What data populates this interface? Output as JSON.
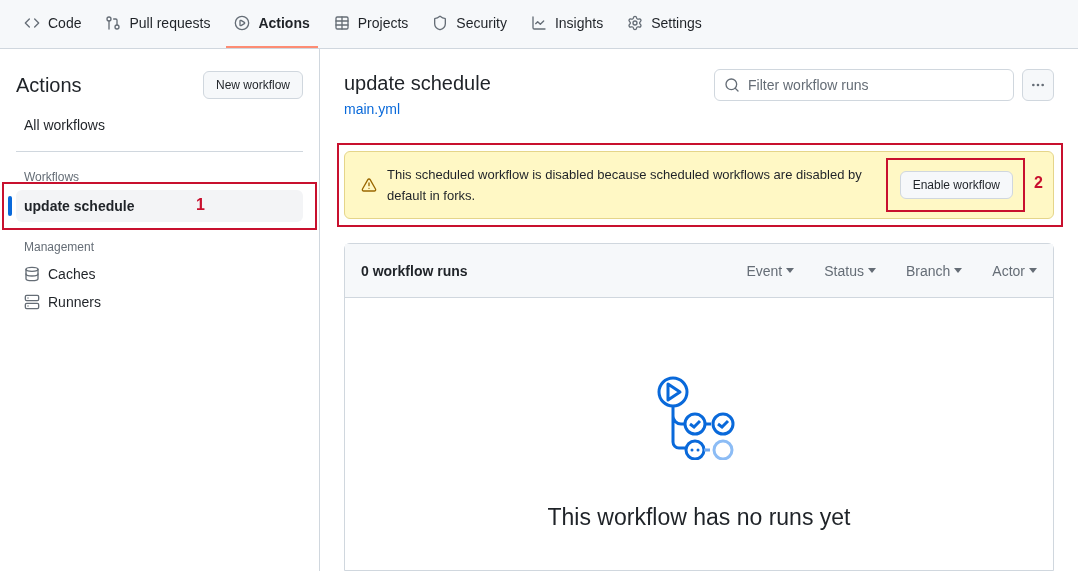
{
  "tabs": [
    {
      "label": "Code",
      "selected": false
    },
    {
      "label": "Pull requests",
      "selected": false
    },
    {
      "label": "Actions",
      "selected": true
    },
    {
      "label": "Projects",
      "selected": false
    },
    {
      "label": "Security",
      "selected": false
    },
    {
      "label": "Insights",
      "selected": false
    },
    {
      "label": "Settings",
      "selected": false
    }
  ],
  "sidebar": {
    "title": "Actions",
    "new_button": "New workflow",
    "all_link": "All workflows",
    "workflows_heading": "Workflows",
    "workflows": [
      {
        "label": "update schedule",
        "selected": true,
        "annotation": "1"
      }
    ],
    "management_heading": "Management",
    "management": [
      {
        "label": "Caches"
      },
      {
        "label": "Runners"
      }
    ]
  },
  "main": {
    "title": "update schedule",
    "file_link": "main.yml",
    "filter": {
      "placeholder": "Filter workflow runs"
    },
    "banner": {
      "message": "This scheduled workflow is disabled because scheduled workflows are disabled by default in forks.",
      "button": "Enable workflow",
      "box_annotated": true,
      "button_annotation": "2"
    },
    "runs": {
      "count": "0 workflow runs",
      "filters": [
        "Event",
        "Status",
        "Branch",
        "Actor"
      ],
      "empty_title": "This workflow has no runs yet"
    }
  }
}
